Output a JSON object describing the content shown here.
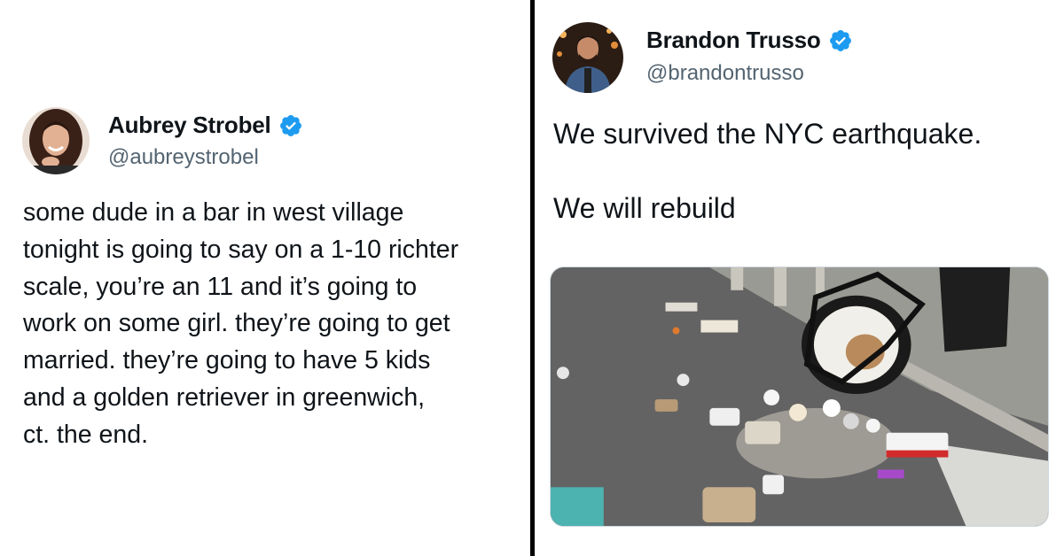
{
  "left_tweet": {
    "display_name": "Aubrey Strobel",
    "handle": "@aubreystrobel",
    "verified": true,
    "text": "some dude in a bar in west village\ntonight is going to say on a 1-10 richter\nscale, you’re an 11 and it’s going to\nwork on some girl. they’re going to get\nmarried. they’re going to have 5 kids\nand a golden retriever in greenwich,\nct. the end."
  },
  "right_tweet": {
    "display_name": "Brandon Trusso",
    "handle": "@brandontrusso",
    "verified": true,
    "text": "We survived the NYC earthquake.\n\nWe will rebuild",
    "media": "photo of a knocked-over trash can with garbage spilled on a street"
  },
  "colors": {
    "verified_badge": "#1d9bf0",
    "handle_text": "#536471",
    "divider": "#000000"
  }
}
